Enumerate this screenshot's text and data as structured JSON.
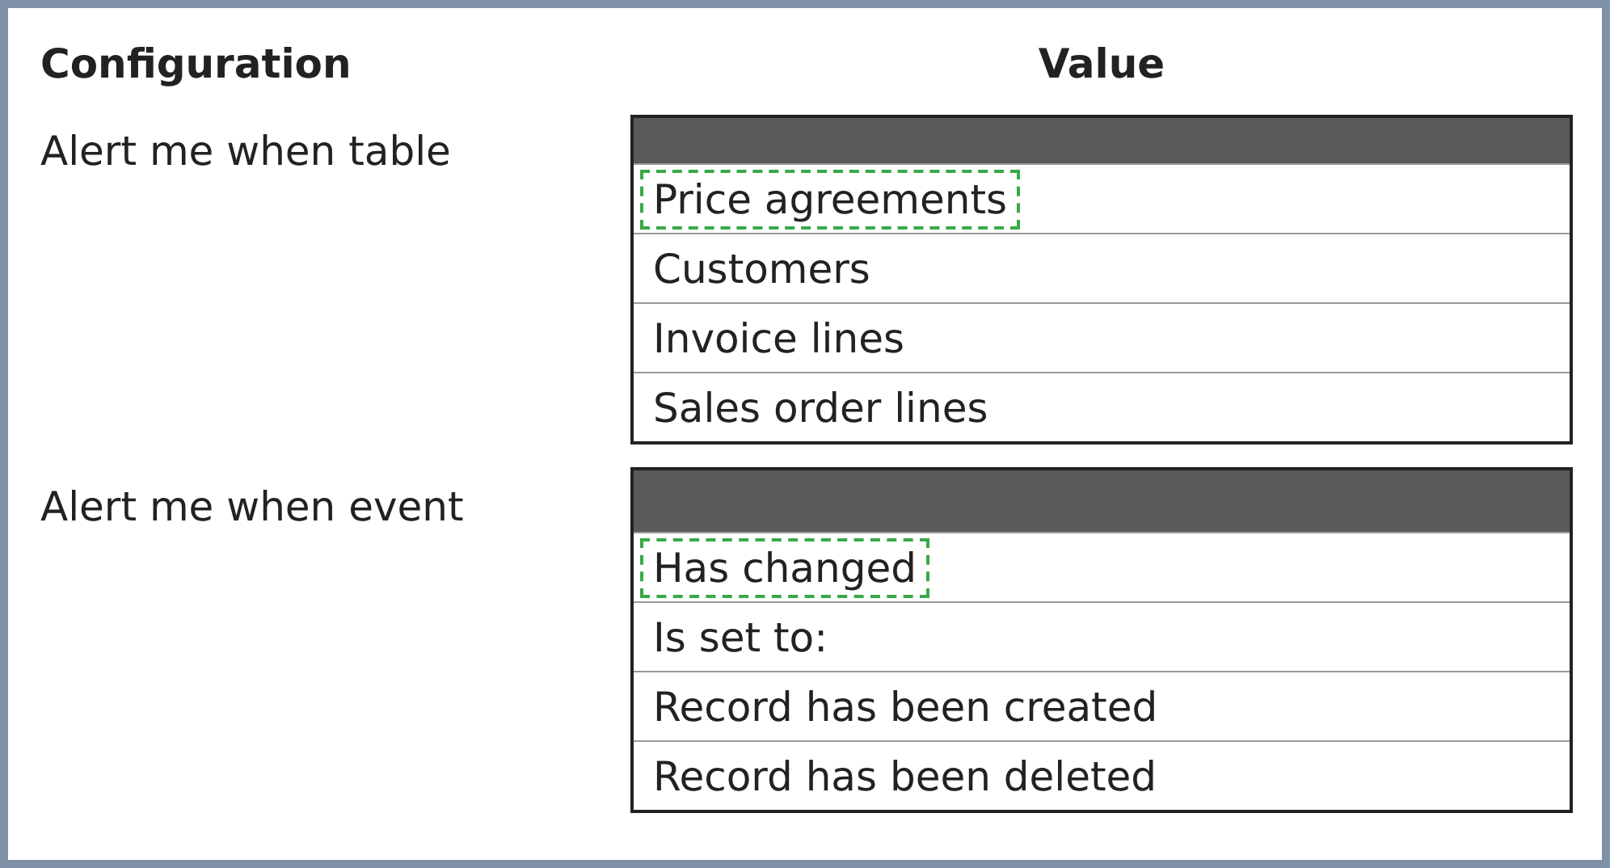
{
  "headers": {
    "configuration": "Configuration",
    "value": "Value"
  },
  "rows": [
    {
      "label": "Alert me when table",
      "options": [
        {
          "text": "Price agreements",
          "selected": true
        },
        {
          "text": "Customers",
          "selected": false
        },
        {
          "text": "Invoice lines",
          "selected": false
        },
        {
          "text": "Sales order lines",
          "selected": false
        }
      ]
    },
    {
      "label": "Alert me when event",
      "options": [
        {
          "text": "Has changed",
          "selected": true
        },
        {
          "text": "Is set to:",
          "selected": false
        },
        {
          "text": "Record has been created",
          "selected": false
        },
        {
          "text": "Record has been deleted",
          "selected": false
        }
      ]
    }
  ]
}
